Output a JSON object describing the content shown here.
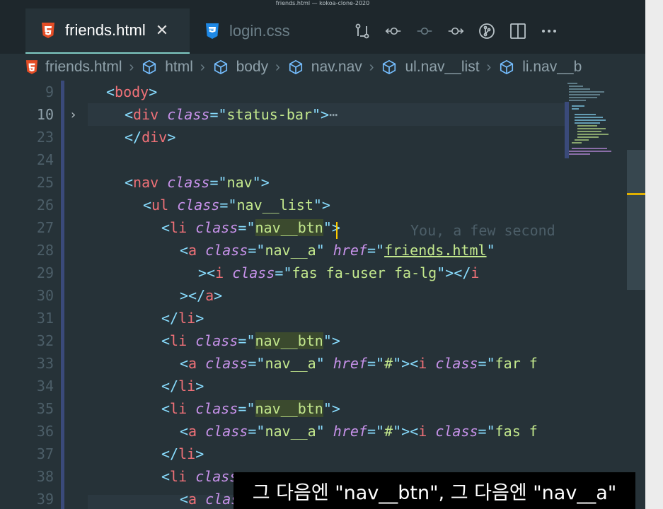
{
  "window": {
    "title": "friends.html — kokoa-clone-2020"
  },
  "tabs": [
    {
      "label": "friends.html",
      "icon": "html5-icon",
      "active": true
    },
    {
      "label": "login.css",
      "icon": "css3-icon",
      "active": false
    }
  ],
  "toolbar": [
    "compare-changes-icon",
    "go-back-icon",
    "timeline-icon",
    "go-forward-icon",
    "git-graph-icon",
    "split-editor-icon",
    "more-actions-icon"
  ],
  "breadcrumb": [
    {
      "label": "friends.html",
      "icon": "html5-icon"
    },
    {
      "label": "html",
      "icon": "cube-icon"
    },
    {
      "label": "body",
      "icon": "cube-icon"
    },
    {
      "label": "nav.nav",
      "icon": "cube-icon"
    },
    {
      "label": "ul.nav__list",
      "icon": "cube-icon"
    },
    {
      "label": "li.nav__b",
      "icon": "cube-icon"
    }
  ],
  "line_numbers": [
    "9",
    "10",
    "23",
    "24",
    "25",
    "26",
    "27",
    "28",
    "29",
    "30",
    "31",
    "32",
    "33",
    "34",
    "35",
    "36",
    "37",
    "38",
    "39"
  ],
  "blame": "You, a few second",
  "subtitle": "그 다음엔 \"nav__btn\", 그 다음엔 \"nav__a\"",
  "colors": {
    "tag": "#f07178",
    "punct": "#89ddff",
    "attr": "#c792ea",
    "string": "#c3e88d",
    "accent": "#80cbc4"
  }
}
